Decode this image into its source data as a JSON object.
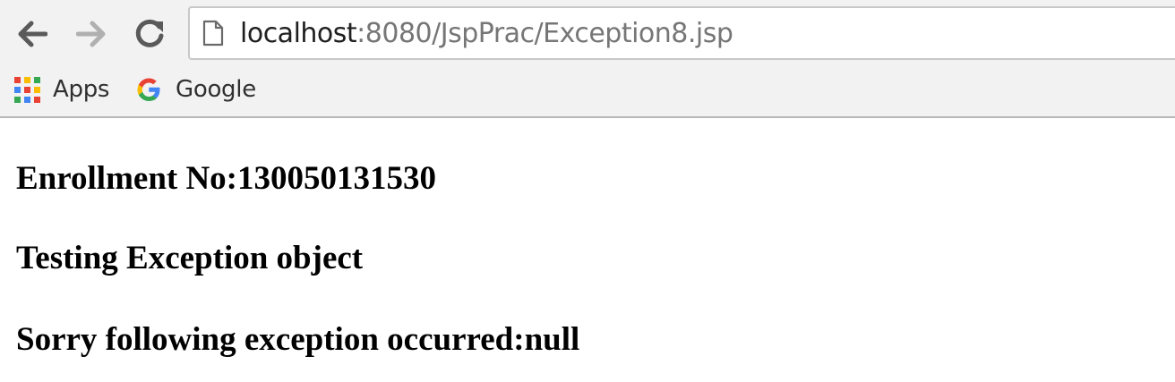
{
  "browser": {
    "url_host": "localhost",
    "url_rest": ":8080/JspPrac/Exception8.jsp",
    "bookmarks": [
      {
        "label": "Apps",
        "icon": "apps-grid-icon"
      },
      {
        "label": "Google",
        "icon": "google-g-icon"
      }
    ],
    "nav_icons": [
      "back-arrow-icon",
      "forward-arrow-icon",
      "reload-icon"
    ]
  },
  "page": {
    "enrollment": "Enrollment No:130050131530",
    "testing": "Testing Exception object",
    "exception": "Sorry following exception occurred:null"
  },
  "colors": {
    "toolbar_bg": "#f2f2f2",
    "apps_grid": [
      "#e94235",
      "#fbbc04",
      "#34a853",
      "#4285f4",
      "#e94235",
      "#fbbc04",
      "#34a853",
      "#4285f4",
      "#e94235"
    ]
  }
}
